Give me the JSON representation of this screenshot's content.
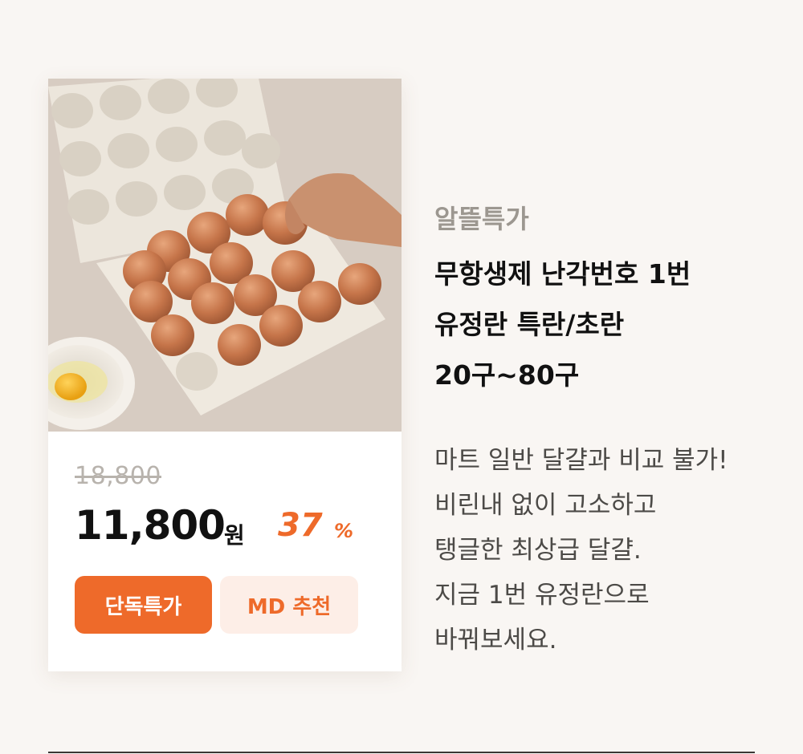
{
  "product": {
    "image_alt": "갈색 달걀이 담긴 난좌를 손으로 집는 모습과 그릇에 깨진 달걀",
    "original_price": "18,800",
    "price": "11,800",
    "currency": "원",
    "discount": "37",
    "discount_symbol": "%",
    "badges": [
      "단독특가",
      "MD 추천"
    ],
    "category": "알뜰특가",
    "title_lines": [
      "무항생제 난각번호 1번",
      "유정란 특란/초란",
      "20구~80구"
    ],
    "description_lines": [
      "마트 일반 달걀과 비교 불가!",
      "비린내 없이 고소하고",
      "탱글한 최상급 달걀.",
      "지금 1번 유정란으로",
      "바꿔보세요."
    ]
  },
  "colors": {
    "background": "#f9f6f3",
    "accent": "#ee6a2a",
    "accent_light": "#fdeee7",
    "strike_price": "#b8b3ad",
    "text_dark": "#111111"
  }
}
